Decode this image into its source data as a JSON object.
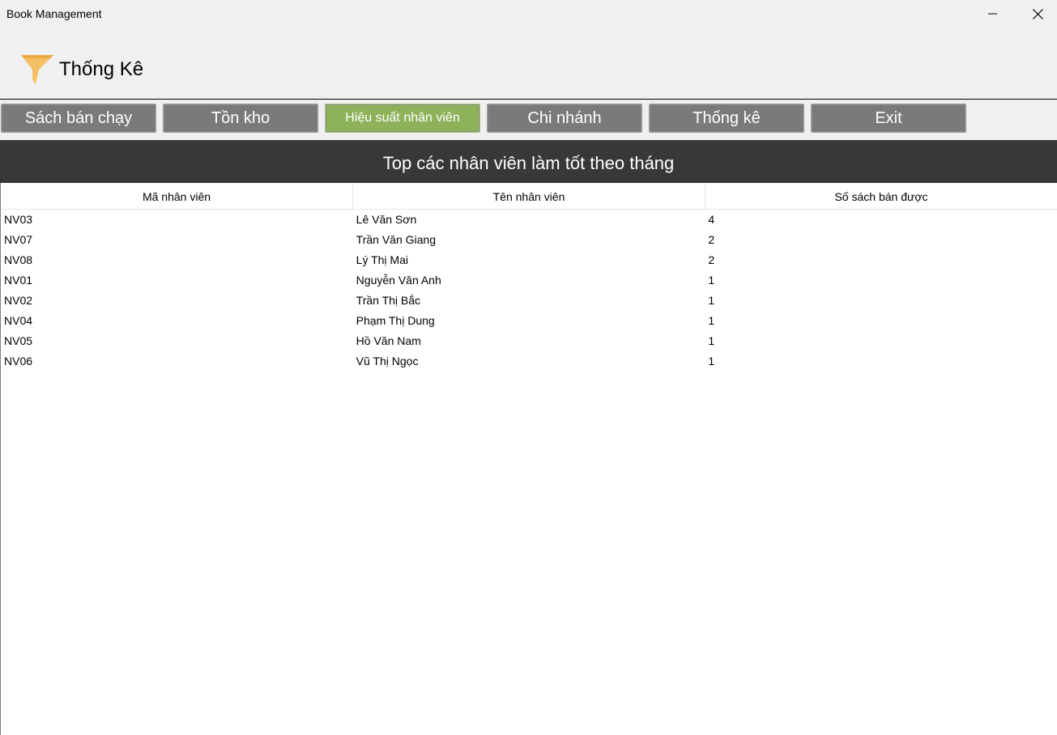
{
  "window": {
    "title": "Book Management"
  },
  "header": {
    "title": "Thống Kê",
    "icon": "funnel-icon",
    "icon_color": "#f5c063"
  },
  "tabs": [
    {
      "label": "Sách bán chạy",
      "active": false
    },
    {
      "label": "Tồn kho",
      "active": false
    },
    {
      "label": "Hiệu suất nhân viên",
      "active": true
    },
    {
      "label": "Chi nhánh",
      "active": false
    },
    {
      "label": "Thống kê",
      "active": false
    },
    {
      "label": "Exit",
      "active": false
    }
  ],
  "colors": {
    "tab": "#7a7a7a",
    "tab_active": "#8db25a",
    "banner": "#383838"
  },
  "banner": {
    "title": "Top các nhân viên làm tốt theo tháng"
  },
  "table": {
    "columns": [
      "Mã nhân viên",
      "Tên nhân viên",
      "Số sách bán được"
    ],
    "rows": [
      [
        "NV03",
        "Lê Văn Sơn",
        "4"
      ],
      [
        "NV07",
        "Trần Văn Giang",
        "2"
      ],
      [
        "NV08",
        "Lý Thị Mai",
        "2"
      ],
      [
        "NV01",
        "Nguyễn Văn Anh",
        "1"
      ],
      [
        "NV02",
        "Trần Thị Bắc",
        "1"
      ],
      [
        "NV04",
        "Phạm Thị Dung",
        "1"
      ],
      [
        "NV05",
        "Hồ Văn Nam",
        "1"
      ],
      [
        "NV06",
        "Vũ Thị Ngọc",
        "1"
      ]
    ]
  }
}
